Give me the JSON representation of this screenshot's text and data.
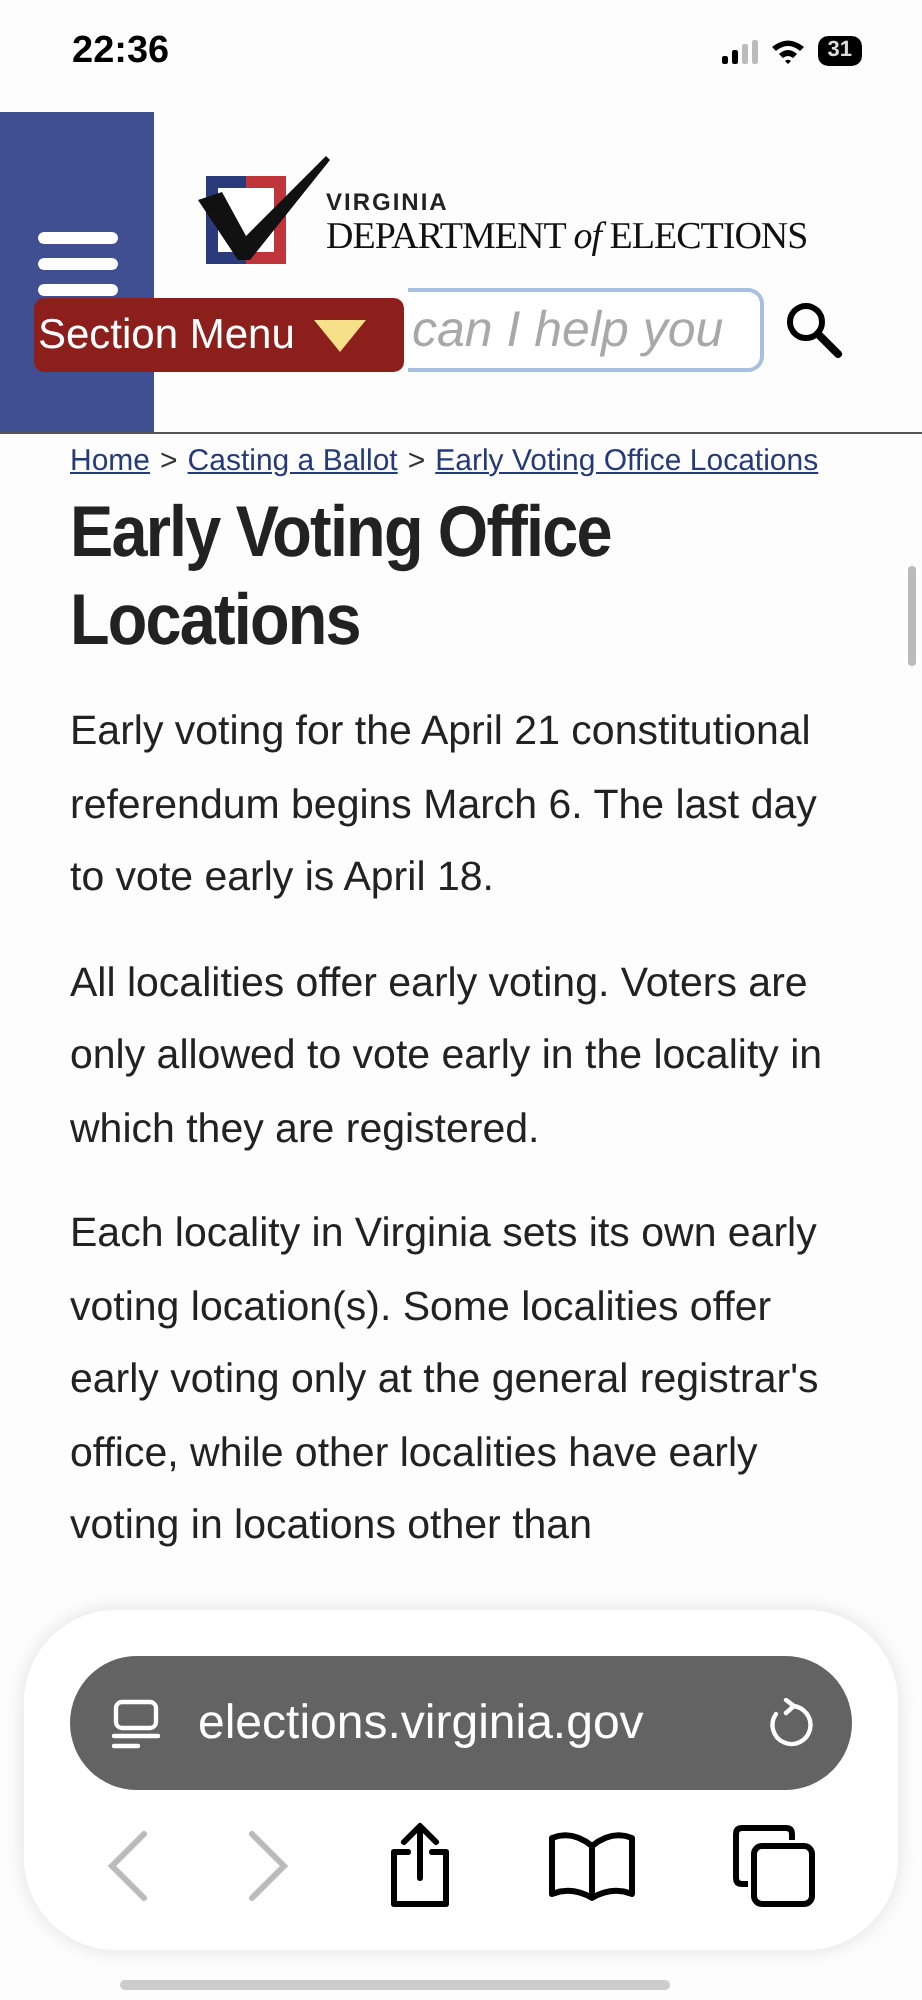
{
  "status_bar": {
    "time": "22:36",
    "battery": "31"
  },
  "header": {
    "logo_small": "VIRGINIA",
    "logo_large": "DEPARTMENT *of* ELECTIONS",
    "section_menu": "Section Menu",
    "search": {
      "placeholder": "can I help you"
    }
  },
  "breadcrumb": [
    {
      "label": "Home"
    },
    {
      "label": "Casting a Ballot"
    },
    {
      "label": "Early Voting Office Locations"
    }
  ],
  "breadcrumb_separator": ">",
  "title": "Early Voting Office Locations",
  "paragraphs": [
    "Early voting for the April 21 constitutional referendum begins March 6. The last day to vote early is April 18.",
    "All localities offer early voting. Voters are only allowed to vote early in the locality in which they are registered.",
    "Each locality in Virginia sets its own early voting location(s). Some localities offer early voting only at the general registrar's office, while other localities have early voting in locations other than"
  ],
  "browser": {
    "url": "elections.virginia.gov",
    "buttons": [
      {
        "kind": "back",
        "disabled": true
      },
      {
        "kind": "forward",
        "disabled": true
      },
      {
        "kind": "share",
        "disabled": false
      },
      {
        "kind": "bookmarks",
        "disabled": false
      },
      {
        "kind": "tabs",
        "disabled": false
      }
    ]
  }
}
